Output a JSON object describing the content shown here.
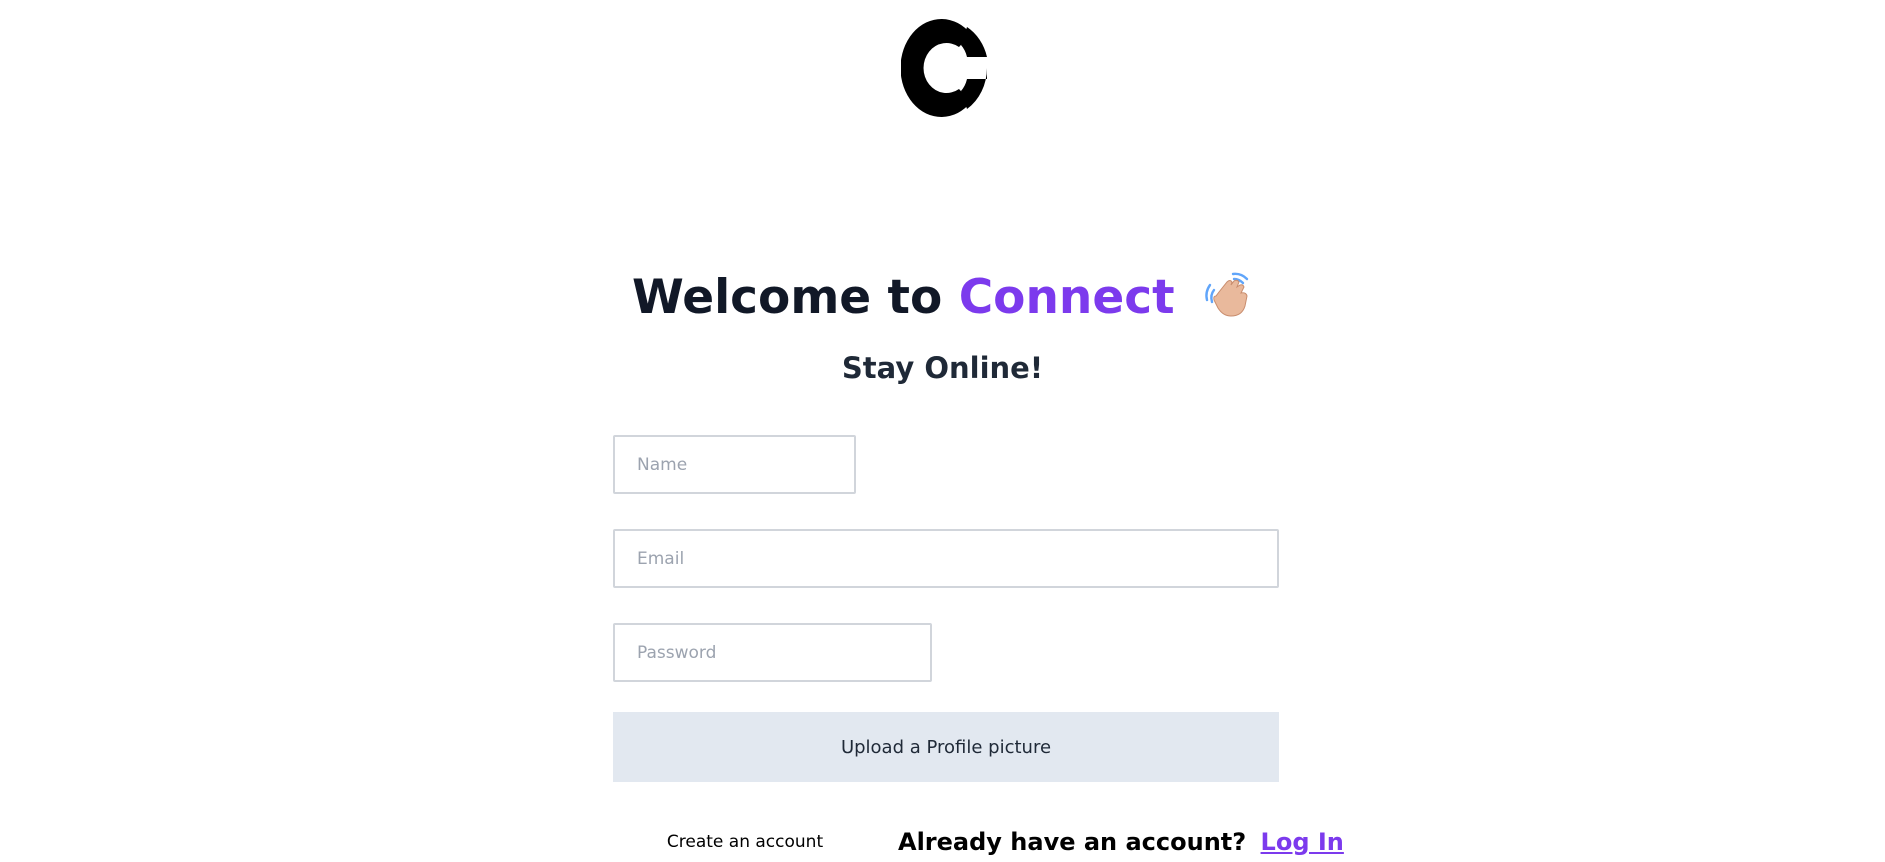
{
  "header": {
    "logo_icon": "connect-logo-icon"
  },
  "hero": {
    "title_prefix": "Welcome to",
    "title_brand": "Connect",
    "wave_icon": "waving-hand-icon",
    "subtitle": "Stay Online!"
  },
  "form": {
    "name_placeholder": "Name",
    "name_value": "",
    "email_placeholder": "Email",
    "email_value": "",
    "password_placeholder": "Password",
    "password_value": "",
    "upload_label": "Upload a Profile picture",
    "create_label": "Create an account"
  },
  "footer": {
    "prompt": "Already have an account?",
    "login_label": "Log In"
  },
  "colors": {
    "brand": "#7c3aed",
    "upload_bg": "#e2e8f0",
    "text_dark": "#111827",
    "input_border": "#d1d5db"
  }
}
